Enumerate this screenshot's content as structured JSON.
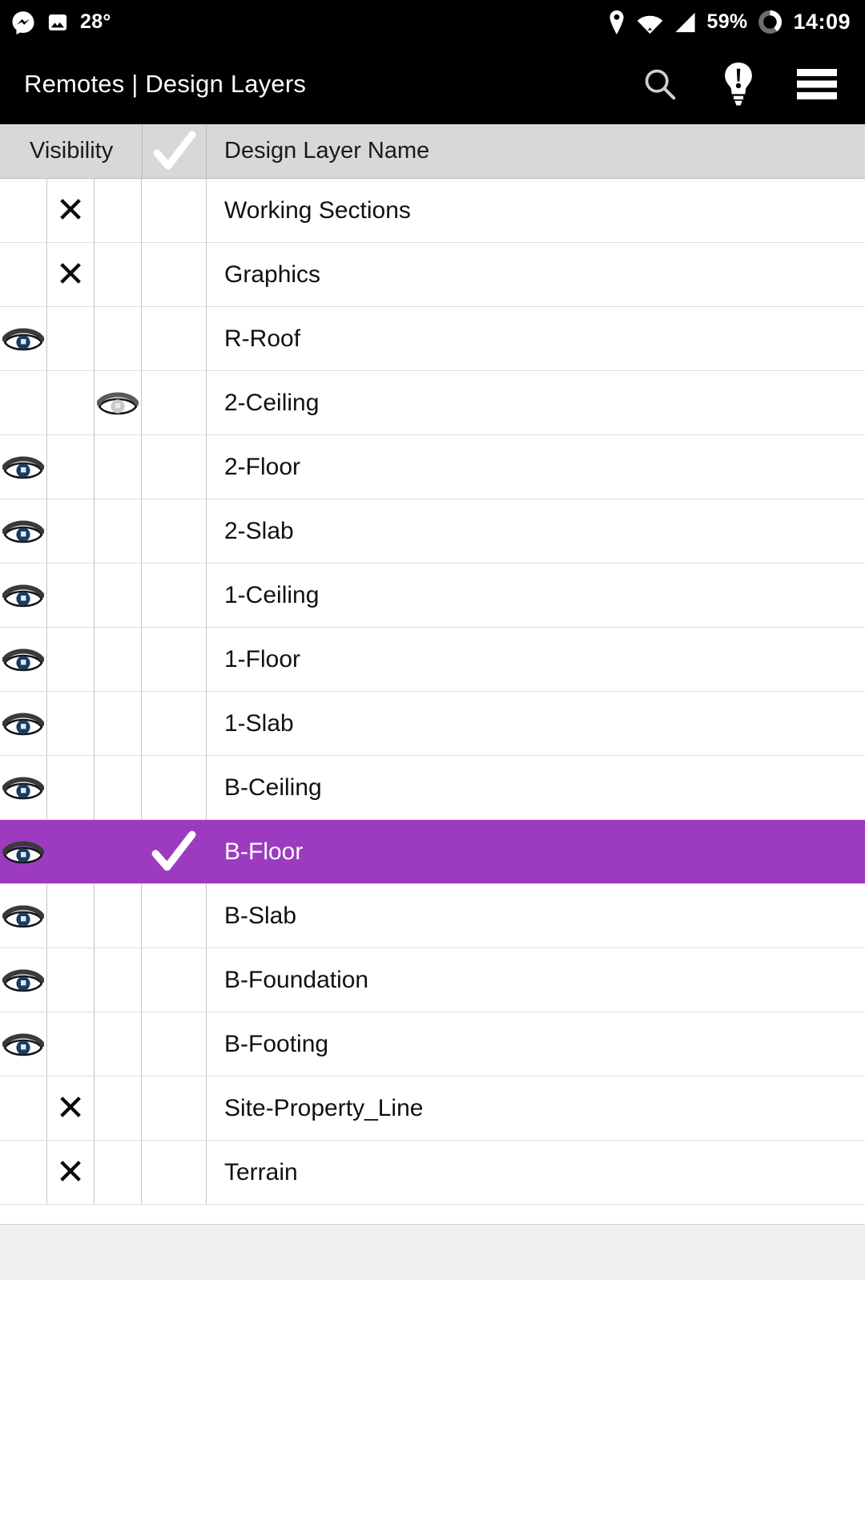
{
  "statusbar": {
    "left_icons": [
      "messenger-icon",
      "photo-icon"
    ],
    "temperature": "28°",
    "right_icons": [
      "location-pin-icon",
      "wifi-icon",
      "cellular-signal-icon"
    ],
    "battery_percent": "59%",
    "battery_icon": "battery-ring-icon",
    "time": "14:09"
  },
  "appbar": {
    "title": "Remotes | Design Layers",
    "search_icon": "search-icon",
    "alert_icon": "alert-bulb-icon",
    "menu_icon": "hamburger-menu-icon"
  },
  "table": {
    "headers": {
      "visibility": "Visibility",
      "check": "check-icon",
      "name": "Design Layer Name"
    },
    "accent_color": "#9C3BC0",
    "rows": [
      {
        "name": "Working Sections",
        "col1": "",
        "col2": "x",
        "col3": "",
        "col4": "",
        "selected": false
      },
      {
        "name": "Graphics",
        "col1": "",
        "col2": "x",
        "col3": "",
        "col4": "",
        "selected": false
      },
      {
        "name": "R-Roof",
        "col1": "eye-blue",
        "col2": "",
        "col3": "",
        "col4": "",
        "selected": false
      },
      {
        "name": "2-Ceiling",
        "col1": "",
        "col2": "",
        "col3": "eye-grey",
        "col4": "",
        "selected": false
      },
      {
        "name": "2-Floor",
        "col1": "eye-blue",
        "col2": "",
        "col3": "",
        "col4": "",
        "selected": false
      },
      {
        "name": "2-Slab",
        "col1": "eye-blue",
        "col2": "",
        "col3": "",
        "col4": "",
        "selected": false
      },
      {
        "name": "1-Ceiling",
        "col1": "eye-blue",
        "col2": "",
        "col3": "",
        "col4": "",
        "selected": false
      },
      {
        "name": "1-Floor",
        "col1": "eye-blue",
        "col2": "",
        "col3": "",
        "col4": "",
        "selected": false
      },
      {
        "name": "1-Slab",
        "col1": "eye-blue",
        "col2": "",
        "col3": "",
        "col4": "",
        "selected": false
      },
      {
        "name": "B-Ceiling",
        "col1": "eye-blue",
        "col2": "",
        "col3": "",
        "col4": "",
        "selected": false
      },
      {
        "name": "B-Floor",
        "col1": "eye-blue",
        "col2": "",
        "col3": "",
        "col4": "check",
        "selected": true
      },
      {
        "name": "B-Slab",
        "col1": "eye-blue",
        "col2": "",
        "col3": "",
        "col4": "",
        "selected": false
      },
      {
        "name": "B-Foundation",
        "col1": "eye-blue",
        "col2": "",
        "col3": "",
        "col4": "",
        "selected": false
      },
      {
        "name": "B-Footing",
        "col1": "eye-blue",
        "col2": "",
        "col3": "",
        "col4": "",
        "selected": false
      },
      {
        "name": "Site-Property_Line",
        "col1": "",
        "col2": "x",
        "col3": "",
        "col4": "",
        "selected": false
      },
      {
        "name": "Terrain",
        "col1": "",
        "col2": "x",
        "col3": "",
        "col4": "",
        "selected": false
      }
    ]
  }
}
